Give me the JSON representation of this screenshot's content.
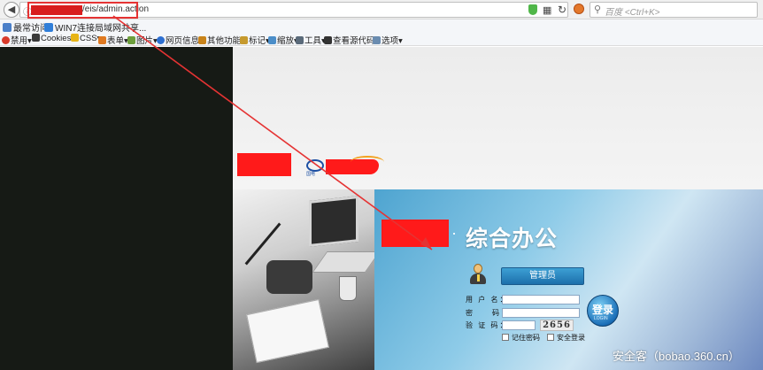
{
  "address_bar": {
    "url_text": "/eis/admin.action"
  },
  "search_bar": {
    "placeholder": "百度 <Ctrl+K>"
  },
  "bookmarks": {
    "items": [
      {
        "label": "最常访问"
      },
      {
        "label": "WIN7连接局域网共享..."
      }
    ]
  },
  "toolbar": {
    "items": [
      {
        "label": "禁用▾"
      },
      {
        "label": "Cookies▾"
      },
      {
        "label": "CSS▾"
      },
      {
        "label": "表单▾"
      },
      {
        "label": "图片▾"
      },
      {
        "label": "网页信息▾"
      },
      {
        "label": "其他功能▾"
      },
      {
        "label": "标记▾"
      },
      {
        "label": "缩放▾"
      },
      {
        "label": "工具▾"
      },
      {
        "label": "查看源代码▾"
      },
      {
        "label": "选项▾"
      }
    ]
  },
  "login": {
    "title": "综合办公",
    "title_separator": "·",
    "logo_emblem_text": "国电",
    "role": "管理员",
    "username_label": "用 户 名：",
    "password_label": "密　　码：",
    "captcha_label": "验 证 码：",
    "captcha_code": "2656",
    "login_button": "登录",
    "login_button_sub": "LOGIN",
    "remember_label": "记住密码",
    "secure_label": "安全登录"
  },
  "watermark": "安全客（bobao.360.cn）",
  "colors": {
    "annotation_red": "#e53333",
    "redaction_red": "#ff1a1a",
    "panel_blue": "#4ea4d0",
    "button_blue": "#1b6fb8"
  }
}
